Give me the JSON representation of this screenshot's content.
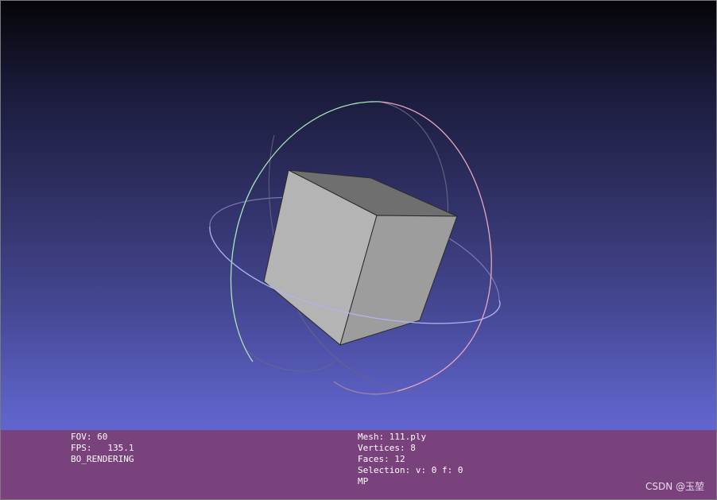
{
  "viewer": {
    "background_top": "#050508",
    "background_bottom": "#6a6ee0",
    "info_bar_color": "#7a427c"
  },
  "info_left": {
    "fov": "FOV: 60",
    "fps": "FPS:   135.1",
    "render_mode": "BO_RENDERING"
  },
  "info_right": {
    "mesh": "Mesh: 111.ply",
    "vertices": "Vertices: 8",
    "faces": "Faces: 12",
    "selection": "Selection: v: 0 f: 0",
    "mode": "MP"
  },
  "watermark": "CSDN @玉堃",
  "colors": {
    "cube_front": "#b4b4b4",
    "cube_right": "#9d9d9d",
    "cube_top": "#6f6f6f",
    "cube_edge": "#2a2a2a",
    "trackball_green": "#a8e6b6",
    "trackball_pink": "#e7a6bd",
    "trackball_blue": "#b0b4ee"
  }
}
